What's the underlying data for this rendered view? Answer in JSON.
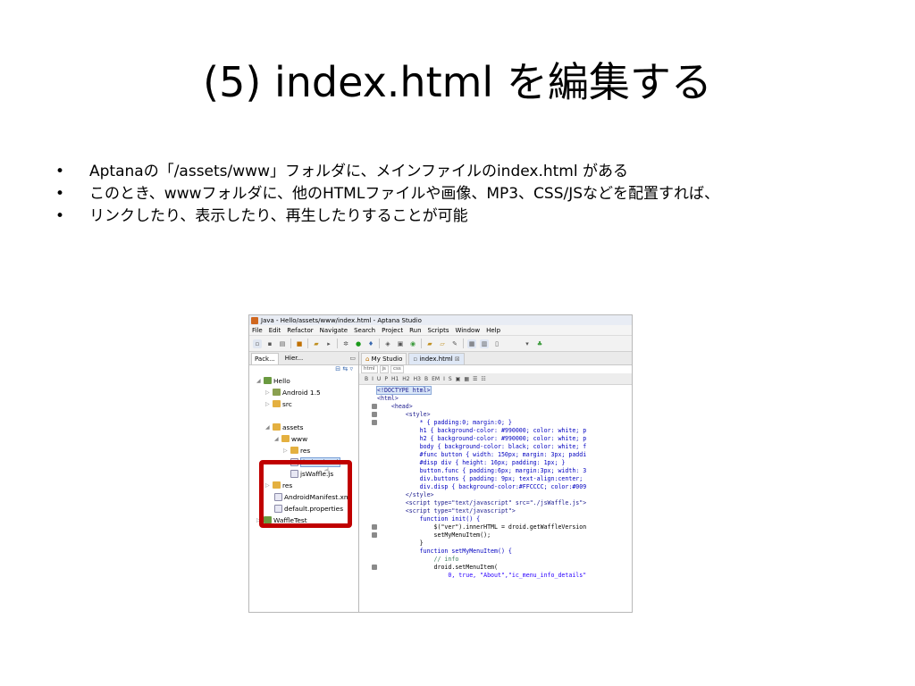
{
  "slide": {
    "title": "(5) index.html を編集する",
    "bullet_marker": "•",
    "bullets": [
      "Aptanaの「/assets/www」フォルダに、メインファイルのindex.html がある",
      "このとき、wwwフォルダに、他のHTMLファイルや画像、MP3、CSS/JSなどを配置すれば、",
      "リンクしたり、表示したり、再生したりすることが可能"
    ]
  },
  "ide": {
    "window_title": "Java - Hello/assets/www/index.html - Aptana Studio",
    "menu": [
      "File",
      "Edit",
      "Refactor",
      "Navigate",
      "Search",
      "Project",
      "Run",
      "Scripts",
      "Window",
      "Help"
    ],
    "left_tabs": [
      "Pack...",
      "Hier..."
    ],
    "tree": [
      {
        "label": "Hello",
        "icon": "project-icon"
      },
      {
        "label": "Android 1.5",
        "icon": "library-icon"
      },
      {
        "label": "src",
        "icon": "folder-icon"
      },
      {
        "label": "assets",
        "icon": "folder-icon"
      },
      {
        "label": "www",
        "icon": "folder-icon"
      },
      {
        "label": "res",
        "icon": "folder-icon"
      },
      {
        "label": "index.html",
        "icon": "file-icon"
      },
      {
        "label": "jsWaffle.js",
        "icon": "file-icon"
      },
      {
        "label": "res",
        "icon": "folder-icon"
      },
      {
        "label": "AndroidManifest.xml",
        "icon": "file-icon"
      },
      {
        "label": "default.properties",
        "icon": "file-icon"
      },
      {
        "label": "WaffleTest",
        "icon": "project-icon"
      }
    ],
    "editor_tabs": [
      "My Studio",
      "index.html"
    ],
    "sub_tabs": [
      "html",
      "js",
      "css"
    ],
    "format_buttons": [
      "B",
      "I",
      "U",
      "P",
      "H1",
      "H2",
      "H3",
      "B",
      "EM",
      "I",
      "S"
    ],
    "code": [
      "<!DOCTYPE html>",
      "<html>",
      "    <head>",
      "        <style>",
      "            * { padding:0; margin:0; }",
      "            h1 { background-color: #990000; color: white; p",
      "            h2 { background-color: #990000; color: white; p",
      "            body { background-color: black; color: white; f",
      "            #func button { width: 150px; margin: 3px; paddi",
      "            #disp div { height: 16px; padding: 1px; }",
      "            button.func { padding:6px; margin:3px; width: 3",
      "            div.buttons { padding: 9px; text-align:center;",
      "            div.disp { background-color:#FFCCCC; color:#009",
      "        </style>",
      "        <script type=\"text/javascript\" src=\"./jsWaffle.js\">",
      "        <script type=\"text/javascript\">",
      "            function init() {",
      "                $(\"ver\").innerHTML = droid.getWaffleVersion",
      "                setMyMenuItem();",
      "            }",
      "            function setMyMenuItem() {",
      "                // info",
      "                droid.setMenuItem(",
      "                    0, true, \"About\",\"ic_menu_info_details\""
    ],
    "colors": {
      "highlight": "#c00000",
      "selection": "#cce0f8"
    }
  }
}
